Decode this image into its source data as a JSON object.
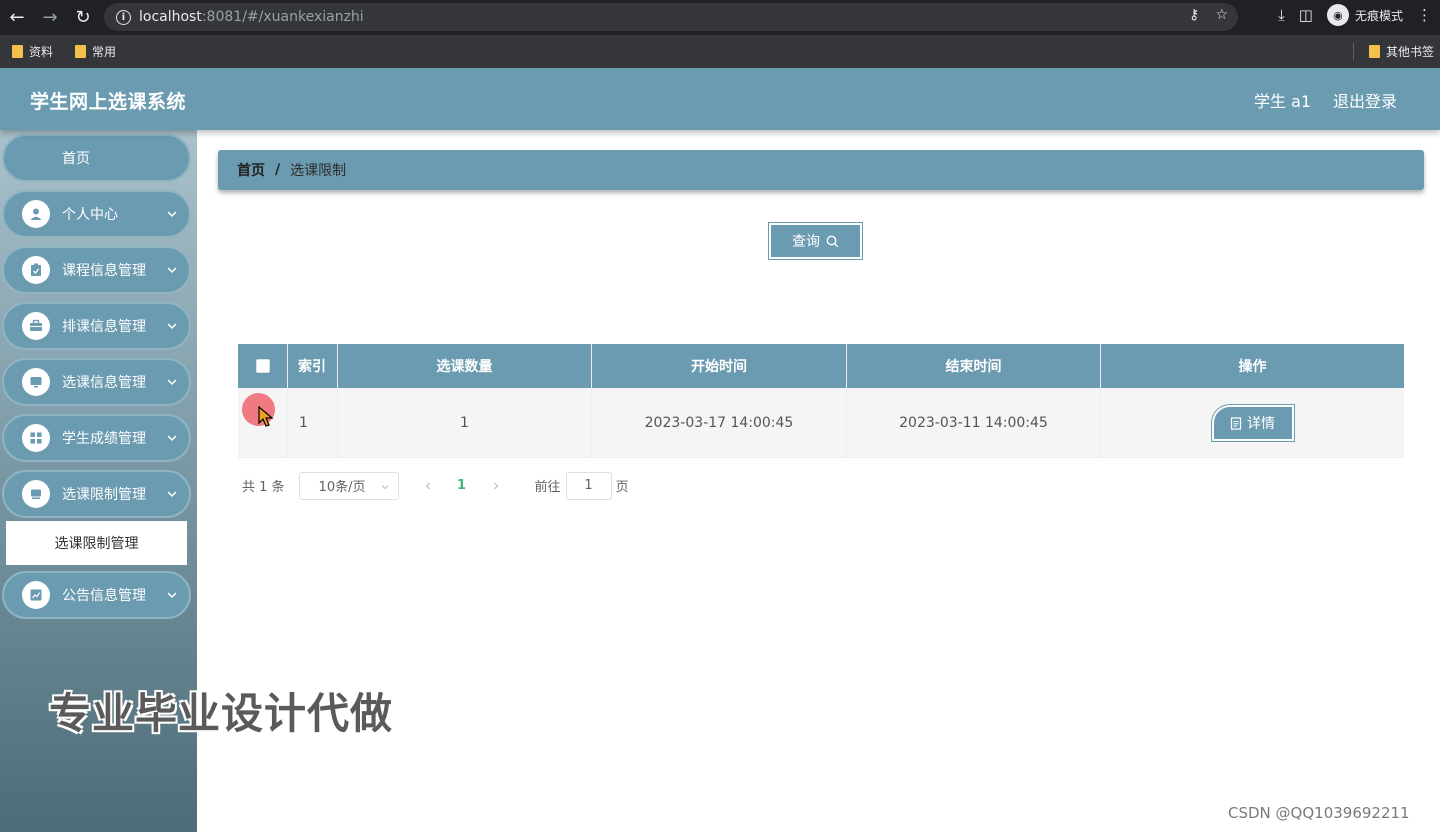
{
  "browser": {
    "url_host": "localhost",
    "url_rest": ":8081/#/xuankexianzhi",
    "incognito_label": "无痕模式",
    "bookmarks": [
      "资料",
      "常用"
    ],
    "other_bookmarks": "其他书签"
  },
  "header": {
    "title": "学生网上选课系统",
    "user": "学生 a1",
    "logout": "退出登录"
  },
  "sidebar": {
    "home": "首页",
    "items": [
      {
        "label": "个人中心",
        "icon": "user-icon"
      },
      {
        "label": "课程信息管理",
        "icon": "clipboard-check-icon"
      },
      {
        "label": "排课信息管理",
        "icon": "briefcase-icon"
      },
      {
        "label": "选课信息管理",
        "icon": "monitor-icon"
      },
      {
        "label": "学生成绩管理",
        "icon": "grid-icon"
      },
      {
        "label": "选课限制管理",
        "icon": "screen-icon"
      },
      {
        "label": "公告信息管理",
        "icon": "chart-icon"
      }
    ],
    "subitem": "选课限制管理"
  },
  "breadcrumb": {
    "home": "首页",
    "separator": "/",
    "current": "选课限制"
  },
  "query_button": "查询",
  "table": {
    "headers": [
      "索引",
      "选课数量",
      "开始时间",
      "结束时间",
      "操作"
    ],
    "rows": [
      {
        "index": "1",
        "count": "1",
        "start": "2023-03-17 14:00:45",
        "end": "2023-03-11 14:00:45",
        "action": "详情"
      }
    ]
  },
  "pagination": {
    "total": "共 1 条",
    "page_size": "10条/页",
    "current_page": "1",
    "goto_prefix": "前往",
    "goto_value": "1",
    "goto_suffix": "页"
  },
  "watermark": "专业毕业设计代做",
  "credit": "CSDN @QQ1039692211",
  "colors": {
    "primary": "#6b9bb0",
    "active_page": "#42b983"
  }
}
